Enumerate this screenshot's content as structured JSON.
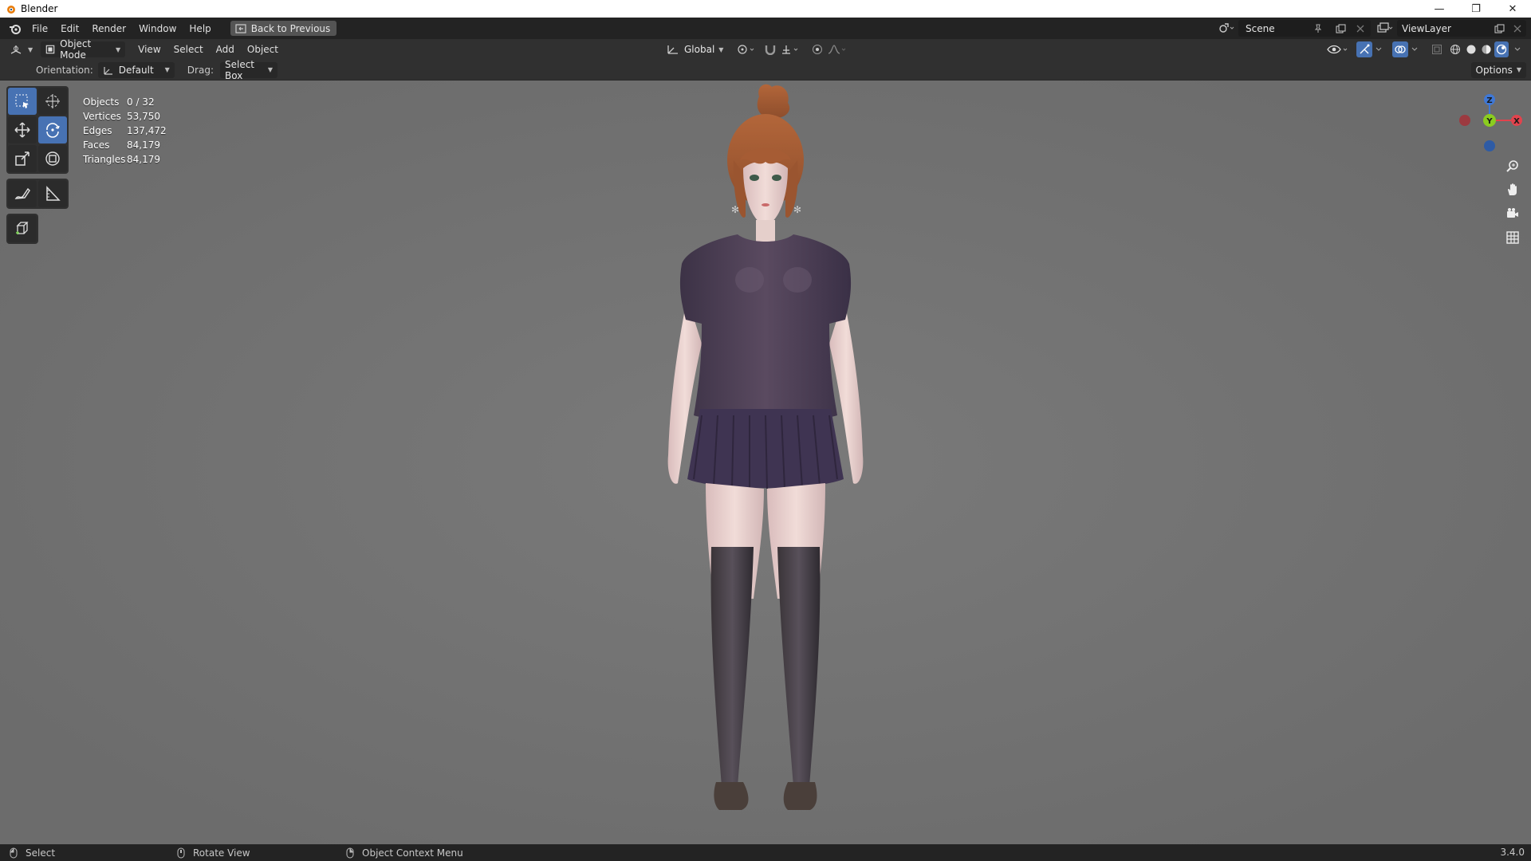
{
  "window": {
    "title": "Blender",
    "minimize": "—",
    "maximize": "❐",
    "close": "✕"
  },
  "topbar": {
    "menus": [
      "File",
      "Edit",
      "Render",
      "Window",
      "Help"
    ],
    "back_button": "Back to Previous",
    "scene": "Scene",
    "view_layer": "ViewLayer"
  },
  "viewport_header": {
    "mode": "Object Mode",
    "menus": [
      "View",
      "Select",
      "Add",
      "Object"
    ],
    "transform_orientation": "Global"
  },
  "tool_header": {
    "orientation_label": "Orientation:",
    "orientation_value": "Default",
    "drag_label": "Drag:",
    "drag_value": "Select Box",
    "options": "Options"
  },
  "stats": [
    {
      "label": "Objects",
      "value": "0 / 32"
    },
    {
      "label": "Vertices",
      "value": "53,750"
    },
    {
      "label": "Edges",
      "value": "137,472"
    },
    {
      "label": "Faces",
      "value": "84,179"
    },
    {
      "label": "Triangles",
      "value": "84,179"
    }
  ],
  "gizmo": {
    "z": "Z",
    "y": "Y",
    "x": "X"
  },
  "statusbar": {
    "left": "Select",
    "middle": "Rotate View",
    "right": "Object Context Menu",
    "version": "3.4.0"
  },
  "colors": {
    "accent": "#4772b3",
    "axis_x": "#e2434d",
    "axis_y": "#8bcc1f",
    "axis_z": "#3f78d6"
  }
}
